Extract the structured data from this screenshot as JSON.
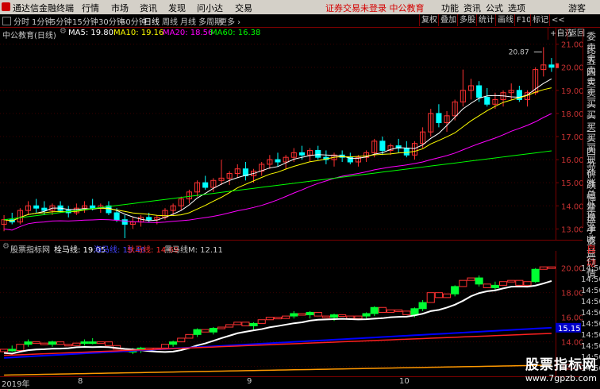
{
  "app": {
    "title": "通达信金融终端"
  },
  "menu": [
    {
      "label": "行情"
    },
    {
      "label": "市场"
    },
    {
      "label": "资讯"
    },
    {
      "label": "发现"
    },
    {
      "label": "问小达"
    },
    {
      "label": "交易"
    }
  ],
  "status": "证券交易未登录  中公教育",
  "right_menu": [
    {
      "label": "功能"
    },
    {
      "label": "资讯"
    },
    {
      "label": "公式"
    },
    {
      "label": "选项"
    },
    {
      "label": "游客"
    }
  ],
  "periods": [
    {
      "label": "分时"
    },
    {
      "label": "1分钟"
    },
    {
      "label": "5分钟"
    },
    {
      "label": "15分钟"
    },
    {
      "label": "30分钟"
    },
    {
      "label": "60分钟"
    },
    {
      "label": "日线"
    },
    {
      "label": "周线"
    },
    {
      "label": "月线"
    },
    {
      "label": "多周期"
    },
    {
      "label": "更多 ›"
    }
  ],
  "right_buttons": [
    {
      "label": "复权"
    },
    {
      "label": "叠加"
    },
    {
      "label": "多股"
    },
    {
      "label": "统计"
    },
    {
      "label": "画线"
    },
    {
      "label": "F10"
    },
    {
      "label": "标记"
    },
    {
      "label": "<<"
    }
  ],
  "second_buttons": [
    {
      "label": "+自选"
    },
    {
      "label": "返回"
    }
  ],
  "colors": {
    "up": "#ff3232",
    "down": "#00ffff",
    "ma5": "#ffffff",
    "ma10": "#ffff00",
    "ma20": "#ff00ff",
    "ma60": "#00ff00",
    "sub_up": "#ff3232",
    "sub_down": "#00ff33",
    "line_white": "#ffffff",
    "line_blue": "#0000ff",
    "line_red": "#ff2020",
    "line_orange": "#ff9900"
  },
  "main": {
    "legend": {
      "name": "中公教育(日线)",
      "ma5": "MA5: 19.80",
      "ma10": "MA10: 19.16",
      "ma20": "MA20: 18.56",
      "ma60": "MA60: 16.38"
    },
    "price_labels": [
      "21.00",
      "20.00",
      "19.00",
      "18.00",
      "17.00",
      "16.00",
      "15.00",
      "14.00",
      "13.00"
    ],
    "price_values": [
      21,
      20,
      19,
      18,
      17,
      16,
      15,
      14,
      13
    ],
    "ylim": [
      12.6,
      21.4
    ],
    "high_label": "20.87",
    "low_label": "12.51"
  },
  "sub": {
    "legend": {
      "name": "股票指标网",
      "l1": "栓马线: 19.05",
      "l2": "海马线: 15.46",
      "l3": "驮马线: 14.69",
      "l4": "黑马线M: 12.11"
    },
    "price_labels": [
      "20.00",
      "18.00",
      "16.00",
      "14.00",
      "12.00"
    ],
    "price_values": [
      20,
      18,
      16,
      14,
      12
    ],
    "ylim": [
      11.2,
      21.4
    ],
    "blue_value": "15.15"
  },
  "xaxis": [
    {
      "label": "2019年"
    },
    {
      "label": "8"
    },
    {
      "label": "9"
    },
    {
      "label": "10"
    }
  ],
  "sidebar1": [
    {
      "label": "委比"
    },
    {
      "label": "卖五"
    },
    {
      "label": "卖四"
    },
    {
      "label": "卖三"
    },
    {
      "label": "卖二"
    },
    {
      "label": "卖一"
    },
    {
      "label": "买一"
    },
    {
      "label": "买二"
    },
    {
      "label": "买三"
    },
    {
      "label": "买四"
    },
    {
      "label": "买五"
    },
    {
      "label": "现价"
    },
    {
      "label": "涨跌"
    },
    {
      "label": "涨幅"
    },
    {
      "label": "总量"
    },
    {
      "label": "外盘"
    },
    {
      "label": "换手"
    },
    {
      "label": "净资"
    },
    {
      "label": "收益"
    }
  ],
  "sidebar2": [
    {
      "label": "自动"
    },
    {
      "label": "行情"
    }
  ],
  "sub_time_labels": [
    "14:50",
    "14:50",
    "14:50",
    "14:50",
    "14:50",
    "14:50",
    "14:50",
    "14:50",
    "14:50",
    "14:50"
  ],
  "watermark": {
    "title": "股票指标网",
    "url": "www.7gpzb.com"
  },
  "chart_data": {
    "type": "candlestick",
    "title": "中公教育(日线)",
    "ylim": [
      12.6,
      21.4
    ],
    "ohlc": [
      [
        13.2,
        13.6,
        12.9,
        13.4
      ],
      [
        13.4,
        13.7,
        13.2,
        13.3
      ],
      [
        13.3,
        13.9,
        13.2,
        13.8
      ],
      [
        13.8,
        14.2,
        13.6,
        14.0
      ],
      [
        14.0,
        14.3,
        13.7,
        13.9
      ],
      [
        13.9,
        14.2,
        13.6,
        13.8
      ],
      [
        13.8,
        14.1,
        13.6,
        14.0
      ],
      [
        14.0,
        14.2,
        13.7,
        13.8
      ],
      [
        13.8,
        14.0,
        13.5,
        13.7
      ],
      [
        13.7,
        14.1,
        13.6,
        13.9
      ],
      [
        13.9,
        14.2,
        13.7,
        14.0
      ],
      [
        14.0,
        14.3,
        13.8,
        13.9
      ],
      [
        13.9,
        14.1,
        13.7,
        14.0
      ],
      [
        14.0,
        14.2,
        13.6,
        13.7
      ],
      [
        13.7,
        13.9,
        13.3,
        13.4
      ],
      [
        13.4,
        13.6,
        12.51,
        13.2
      ],
      [
        13.2,
        13.5,
        13.0,
        13.3
      ],
      [
        13.3,
        13.6,
        13.1,
        13.5
      ],
      [
        13.5,
        13.7,
        13.3,
        13.4
      ],
      [
        13.4,
        13.6,
        13.2,
        13.5
      ],
      [
        13.5,
        13.9,
        13.4,
        13.8
      ],
      [
        13.8,
        14.1,
        13.6,
        14.0
      ],
      [
        14.0,
        14.4,
        13.8,
        14.3
      ],
      [
        14.3,
        14.7,
        14.1,
        14.6
      ],
      [
        14.6,
        15.1,
        14.4,
        15.0
      ],
      [
        15.0,
        15.3,
        14.7,
        14.8
      ],
      [
        14.8,
        15.2,
        14.6,
        15.1
      ],
      [
        15.1,
        16.0,
        14.9,
        15.2
      ],
      [
        15.2,
        15.5,
        14.9,
        15.4
      ],
      [
        15.4,
        15.8,
        15.2,
        15.6
      ],
      [
        15.6,
        15.9,
        15.1,
        15.3
      ],
      [
        15.3,
        15.6,
        15.0,
        15.5
      ],
      [
        15.5,
        15.9,
        15.3,
        15.8
      ],
      [
        15.8,
        16.2,
        15.6,
        16.0
      ],
      [
        16.0,
        16.3,
        15.7,
        15.9
      ],
      [
        15.9,
        16.2,
        15.6,
        16.1
      ],
      [
        16.1,
        16.5,
        15.9,
        16.3
      ],
      [
        16.3,
        16.6,
        16.0,
        16.2
      ],
      [
        16.2,
        16.5,
        15.9,
        16.4
      ],
      [
        16.4,
        16.6,
        16.0,
        16.1
      ],
      [
        16.1,
        16.4,
        15.8,
        16.0
      ],
      [
        16.0,
        16.3,
        15.7,
        16.2
      ],
      [
        16.2,
        16.4,
        15.9,
        16.1
      ],
      [
        16.1,
        16.3,
        15.8,
        15.9
      ],
      [
        15.9,
        16.2,
        15.7,
        16.1
      ],
      [
        16.1,
        16.4,
        15.9,
        16.3
      ],
      [
        16.3,
        16.9,
        16.1,
        16.8
      ],
      [
        16.8,
        17.0,
        16.2,
        16.4
      ],
      [
        16.4,
        16.7,
        16.2,
        16.6
      ],
      [
        16.6,
        16.9,
        16.3,
        16.5
      ],
      [
        16.5,
        16.8,
        16.1,
        16.2
      ],
      [
        16.2,
        16.8,
        16.0,
        16.7
      ],
      [
        16.7,
        17.4,
        16.5,
        17.2
      ],
      [
        17.2,
        18.2,
        17.0,
        18.0
      ],
      [
        18.0,
        18.4,
        17.4,
        17.6
      ],
      [
        17.6,
        18.1,
        17.2,
        17.9
      ],
      [
        17.9,
        18.6,
        17.7,
        18.5
      ],
      [
        18.5,
        19.9,
        18.3,
        19.0
      ],
      [
        19.0,
        19.5,
        18.6,
        19.2
      ],
      [
        19.2,
        19.4,
        18.5,
        18.7
      ],
      [
        18.7,
        19.1,
        18.3,
        18.4
      ],
      [
        18.4,
        18.9,
        18.2,
        18.6
      ],
      [
        18.6,
        19.0,
        18.3,
        18.9
      ],
      [
        18.9,
        19.3,
        18.6,
        19.0
      ],
      [
        19.0,
        19.2,
        18.5,
        18.6
      ],
      [
        18.6,
        19.0,
        18.3,
        18.9
      ],
      [
        18.9,
        20.0,
        18.8,
        19.9
      ],
      [
        19.9,
        20.87,
        19.6,
        20.1
      ],
      [
        20.1,
        20.4,
        19.8,
        20.0
      ]
    ],
    "ma": {
      "MA5": 19.8,
      "MA10": 19.16,
      "MA20": 18.56,
      "MA60": 16.38
    }
  }
}
